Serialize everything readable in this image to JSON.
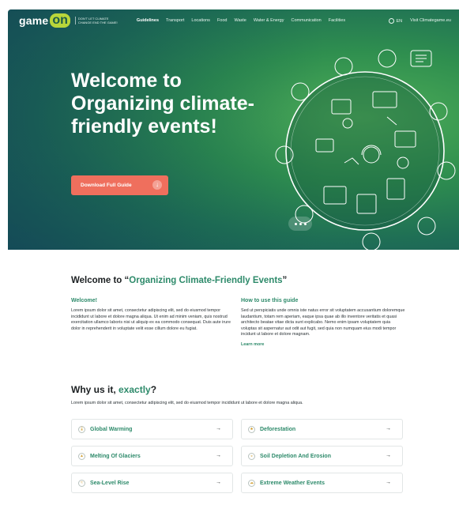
{
  "nav": {
    "logo_text": "game",
    "logo_on": "on",
    "logo_tagline": "Don't let climate change end the game!",
    "menu": [
      {
        "label": "Guidelines",
        "active": true
      },
      {
        "label": "Transport"
      },
      {
        "label": "Locations"
      },
      {
        "label": "Food"
      },
      {
        "label": "Waste"
      },
      {
        "label": "Water & Energy"
      },
      {
        "label": "Communication"
      },
      {
        "label": "Facilities"
      }
    ],
    "language": "EN",
    "visit_link": "Visit Climategame.eu"
  },
  "hero": {
    "title": "Welcome to Organizing climate-friendly events!",
    "cta_label": "Download Full Guide",
    "cta_icon": "download-icon"
  },
  "welcome": {
    "heading_prefix": "Welcome to “",
    "heading_highlight": "Organizing Climate-Friendly Events",
    "heading_suffix": "”",
    "left_title": "Welcome!",
    "left_text": "Lorem ipsum dolor sit amet, consectetur adipiscing elit, sed do eiusmod tempor incididunt ut labore et dolore magna aliqua. Ut enim ad minim veniam, quis nostrud exercitation ullamco laboris nisi ut aliquip ex ea commodo consequat. Duis aute irure dolor in reprehenderit in voluptate velit esse cillum dolore eu fugiat.",
    "right_title": "How to use this guide",
    "right_text": "Sed ut perspiciatis unde omnis iste natus error sit voluptatem accusantium doloremque laudantium, totam rem aperiam, eaque ipsa quae ab illo inventore veritatis et quasi architecto beatae vitae dicta sunt explicabo. Nemo enim ipsam voluptatem quia voluptas sit aspernatur aut odit aut fugit, sed quia non numquam eius modi tempor incidunt ut labore et dolore magnam.",
    "learn_more": "Learn more"
  },
  "why": {
    "heading_prefix": "Why us it, ",
    "heading_highlight": "exactly",
    "heading_suffix": "?",
    "text": "Lorem ipsum dolor sit amet, consectetur adipiscing elit, sed do eiusmod tempor incididunt ut labore et dolore magna aliqua.",
    "cards": [
      {
        "label": "Global Warming",
        "icon": "thermometer-icon"
      },
      {
        "label": "Deforestation",
        "icon": "tree-icon"
      },
      {
        "label": "Melting Of Glaciers",
        "icon": "glacier-icon"
      },
      {
        "label": "Soil Depletion And Erosion",
        "icon": "soil-icon"
      },
      {
        "label": "Sea-Level Rise",
        "icon": "wave-icon"
      },
      {
        "label": "Extreme Weather Events",
        "icon": "storm-icon"
      }
    ],
    "arrow": "→"
  },
  "colors": {
    "accent_green": "#2d8a6a",
    "cta_coral": "#ef6f5d",
    "logo_lime": "#b9d63a"
  }
}
